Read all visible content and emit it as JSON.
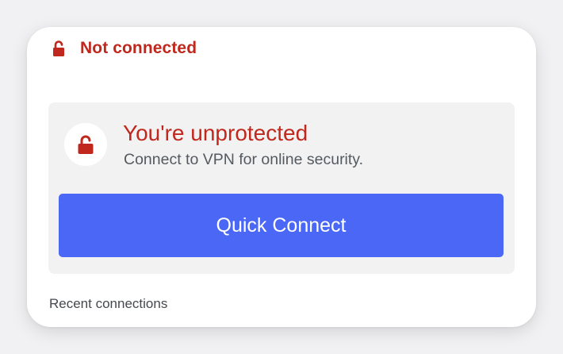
{
  "status": {
    "icon": "lock-open-icon",
    "text": "Not connected",
    "color": "#c0271d"
  },
  "protection_panel": {
    "icon": "lock-open-icon",
    "headline": "You're unprotected",
    "subline": "Connect to VPN for online security.",
    "quick_connect_label": "Quick Connect",
    "button_color": "#4a67f5"
  },
  "recent": {
    "label": "Recent connections"
  }
}
